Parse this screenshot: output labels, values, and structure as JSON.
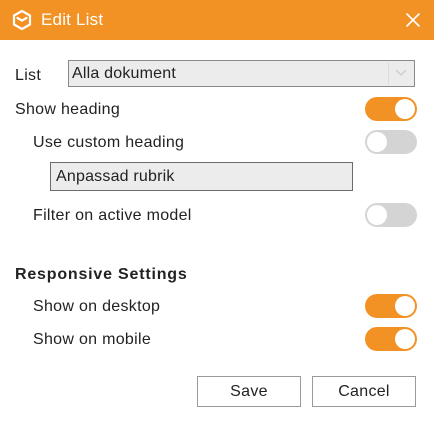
{
  "dialog": {
    "title": "Edit List",
    "logo_icon": "cube-logo-icon",
    "close_icon": "close-icon",
    "accent_color": "#f29224"
  },
  "list": {
    "label": "List",
    "selected": "Alla dokument",
    "arrow_icon": "chevron-down-icon"
  },
  "show_heading": {
    "label": "Show heading",
    "enabled": true
  },
  "use_custom_heading": {
    "label": "Use custom heading",
    "enabled": false
  },
  "custom_heading": {
    "value": "Anpassad rubrik"
  },
  "filter_active_model": {
    "label": "Filter on active model",
    "enabled": false
  },
  "responsive": {
    "heading": "Responsive Settings",
    "desktop": {
      "label": "Show on desktop",
      "enabled": true
    },
    "mobile": {
      "label": "Show on mobile",
      "enabled": true
    }
  },
  "buttons": {
    "save": "Save",
    "cancel": "Cancel"
  }
}
